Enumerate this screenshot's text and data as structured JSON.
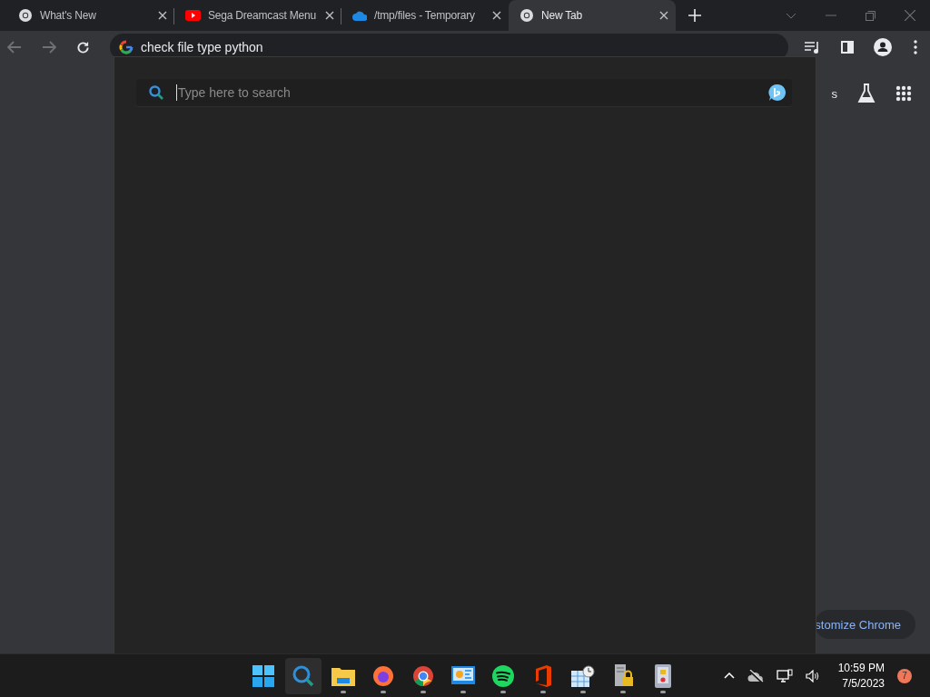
{
  "tabs": [
    {
      "kind": "ring",
      "title": "What's New",
      "selected": false
    },
    {
      "kind": "play",
      "title": "Sega Dreamcast Menu",
      "selected": false
    },
    {
      "kind": "cloud",
      "title": "/tmp/files - Temporary",
      "selected": false
    },
    {
      "kind": "ring",
      "title": "New Tab",
      "selected": true
    }
  ],
  "address_bar": {
    "value": "check file type python"
  },
  "page": {
    "header_link": "s",
    "customize_button": "stomize Chrome"
  },
  "search_flyout": {
    "placeholder": "Type here to search"
  },
  "taskbar": {
    "apps": [
      {
        "kind": "start",
        "selected": false,
        "running": false
      },
      {
        "kind": "search",
        "selected": true,
        "running": false
      },
      {
        "kind": "folder",
        "selected": false,
        "running": true
      },
      {
        "kind": "fox",
        "selected": false,
        "running": true
      },
      {
        "kind": "ring",
        "selected": false,
        "running": true
      },
      {
        "kind": "panel",
        "selected": false,
        "running": true
      },
      {
        "kind": "waves",
        "selected": false,
        "running": true
      },
      {
        "kind": "office",
        "selected": false,
        "running": true
      },
      {
        "kind": "calendar",
        "selected": false,
        "running": true
      },
      {
        "kind": "server",
        "selected": false,
        "running": true
      },
      {
        "kind": "device",
        "selected": false,
        "running": true
      }
    ],
    "time": "10:59 PM",
    "date": "7/5/2023",
    "notifications": "7"
  }
}
